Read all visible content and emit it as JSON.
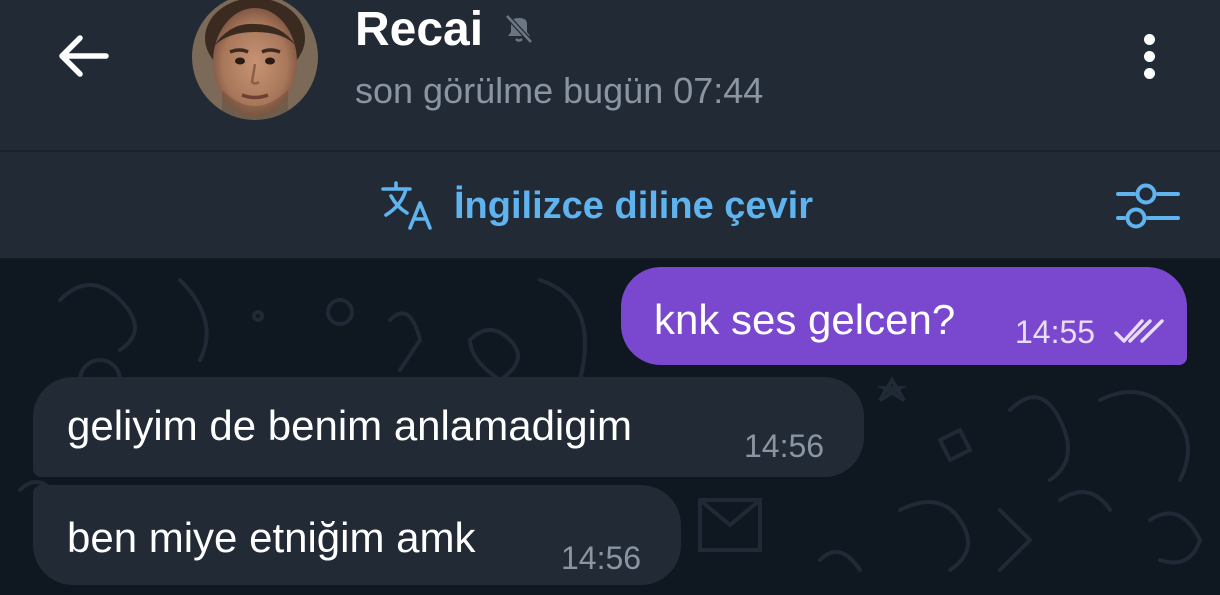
{
  "header": {
    "contact_name": "Recai",
    "last_seen": "son görülme bugün 07:44",
    "muted": true,
    "icons": {
      "back": "arrow-left-icon",
      "mute": "muted-bell-icon",
      "menu": "more-vertical-icon"
    }
  },
  "translate_bar": {
    "label": "İngilizce diline çevir",
    "icons": {
      "translate": "translate-icon",
      "settings": "sliders-icon"
    },
    "accent_color": "#5fb3ee"
  },
  "messages": [
    {
      "direction": "outgoing",
      "text": "knk ses gelcen?",
      "time": "14:55",
      "status": "read"
    },
    {
      "direction": "incoming",
      "text": "geliyim de benim anlamadigim",
      "time": "14:56"
    },
    {
      "direction": "incoming",
      "text": "ben miye etniğim amk",
      "time": "14:56"
    }
  ],
  "colors": {
    "header_bg": "#222a36",
    "chat_bg": "#0f1720",
    "outgoing_bubble": "#7a48cf",
    "incoming_bubble": "#222a36",
    "secondary_text": "#8a95a3"
  }
}
